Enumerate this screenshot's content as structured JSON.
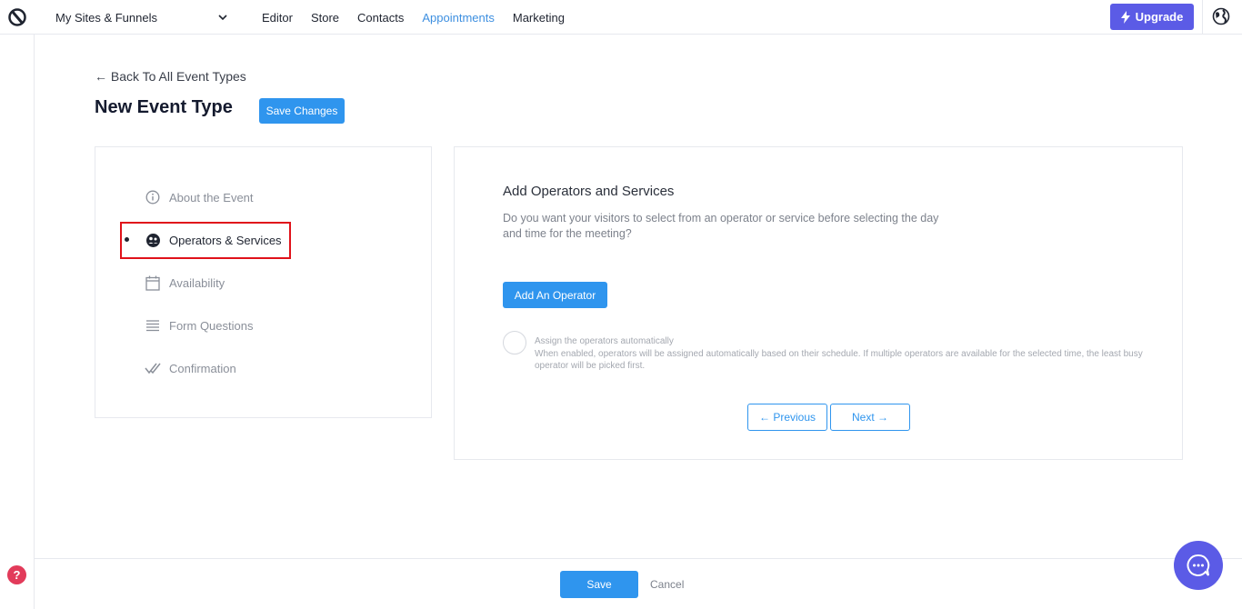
{
  "topbar": {
    "site_select": "My Sites & Funnels",
    "nav": [
      "Editor",
      "Store",
      "Contacts",
      "Appointments",
      "Marketing"
    ],
    "active_nav": "Appointments",
    "upgrade_label": "Upgrade"
  },
  "header": {
    "back_label": "← Back To All Event Types",
    "title": "New Event Type",
    "save_changes_label": "Save Changes"
  },
  "steps": [
    {
      "label": "About the Event",
      "icon": "info-icon"
    },
    {
      "label": "Operators & Services",
      "icon": "operators-icon",
      "active": true
    },
    {
      "label": "Availability",
      "icon": "calendar-icon"
    },
    {
      "label": "Form Questions",
      "icon": "list-icon"
    },
    {
      "label": "Confirmation",
      "icon": "check-icon"
    }
  ],
  "content": {
    "title": "Add Operators and Services",
    "description": "Do you want your visitors to select from an operator or service before selecting the day and time for the meeting?",
    "add_operator_label": "Add An Operator",
    "auto_assign_title": "Assign the operators automatically",
    "auto_assign_desc": "When enabled, operators will be assigned automatically based on their schedule. If multiple operators are available for the selected time, the least busy operator will be picked first.",
    "previous_label": "← Previous",
    "next_label": "Next →"
  },
  "footer": {
    "save_label": "Save",
    "cancel_label": "Cancel"
  },
  "colors": {
    "accent": "#2f95ee",
    "upgrade": "#5b5be6",
    "highlight": "#e0121a",
    "help": "#e23b5a"
  }
}
